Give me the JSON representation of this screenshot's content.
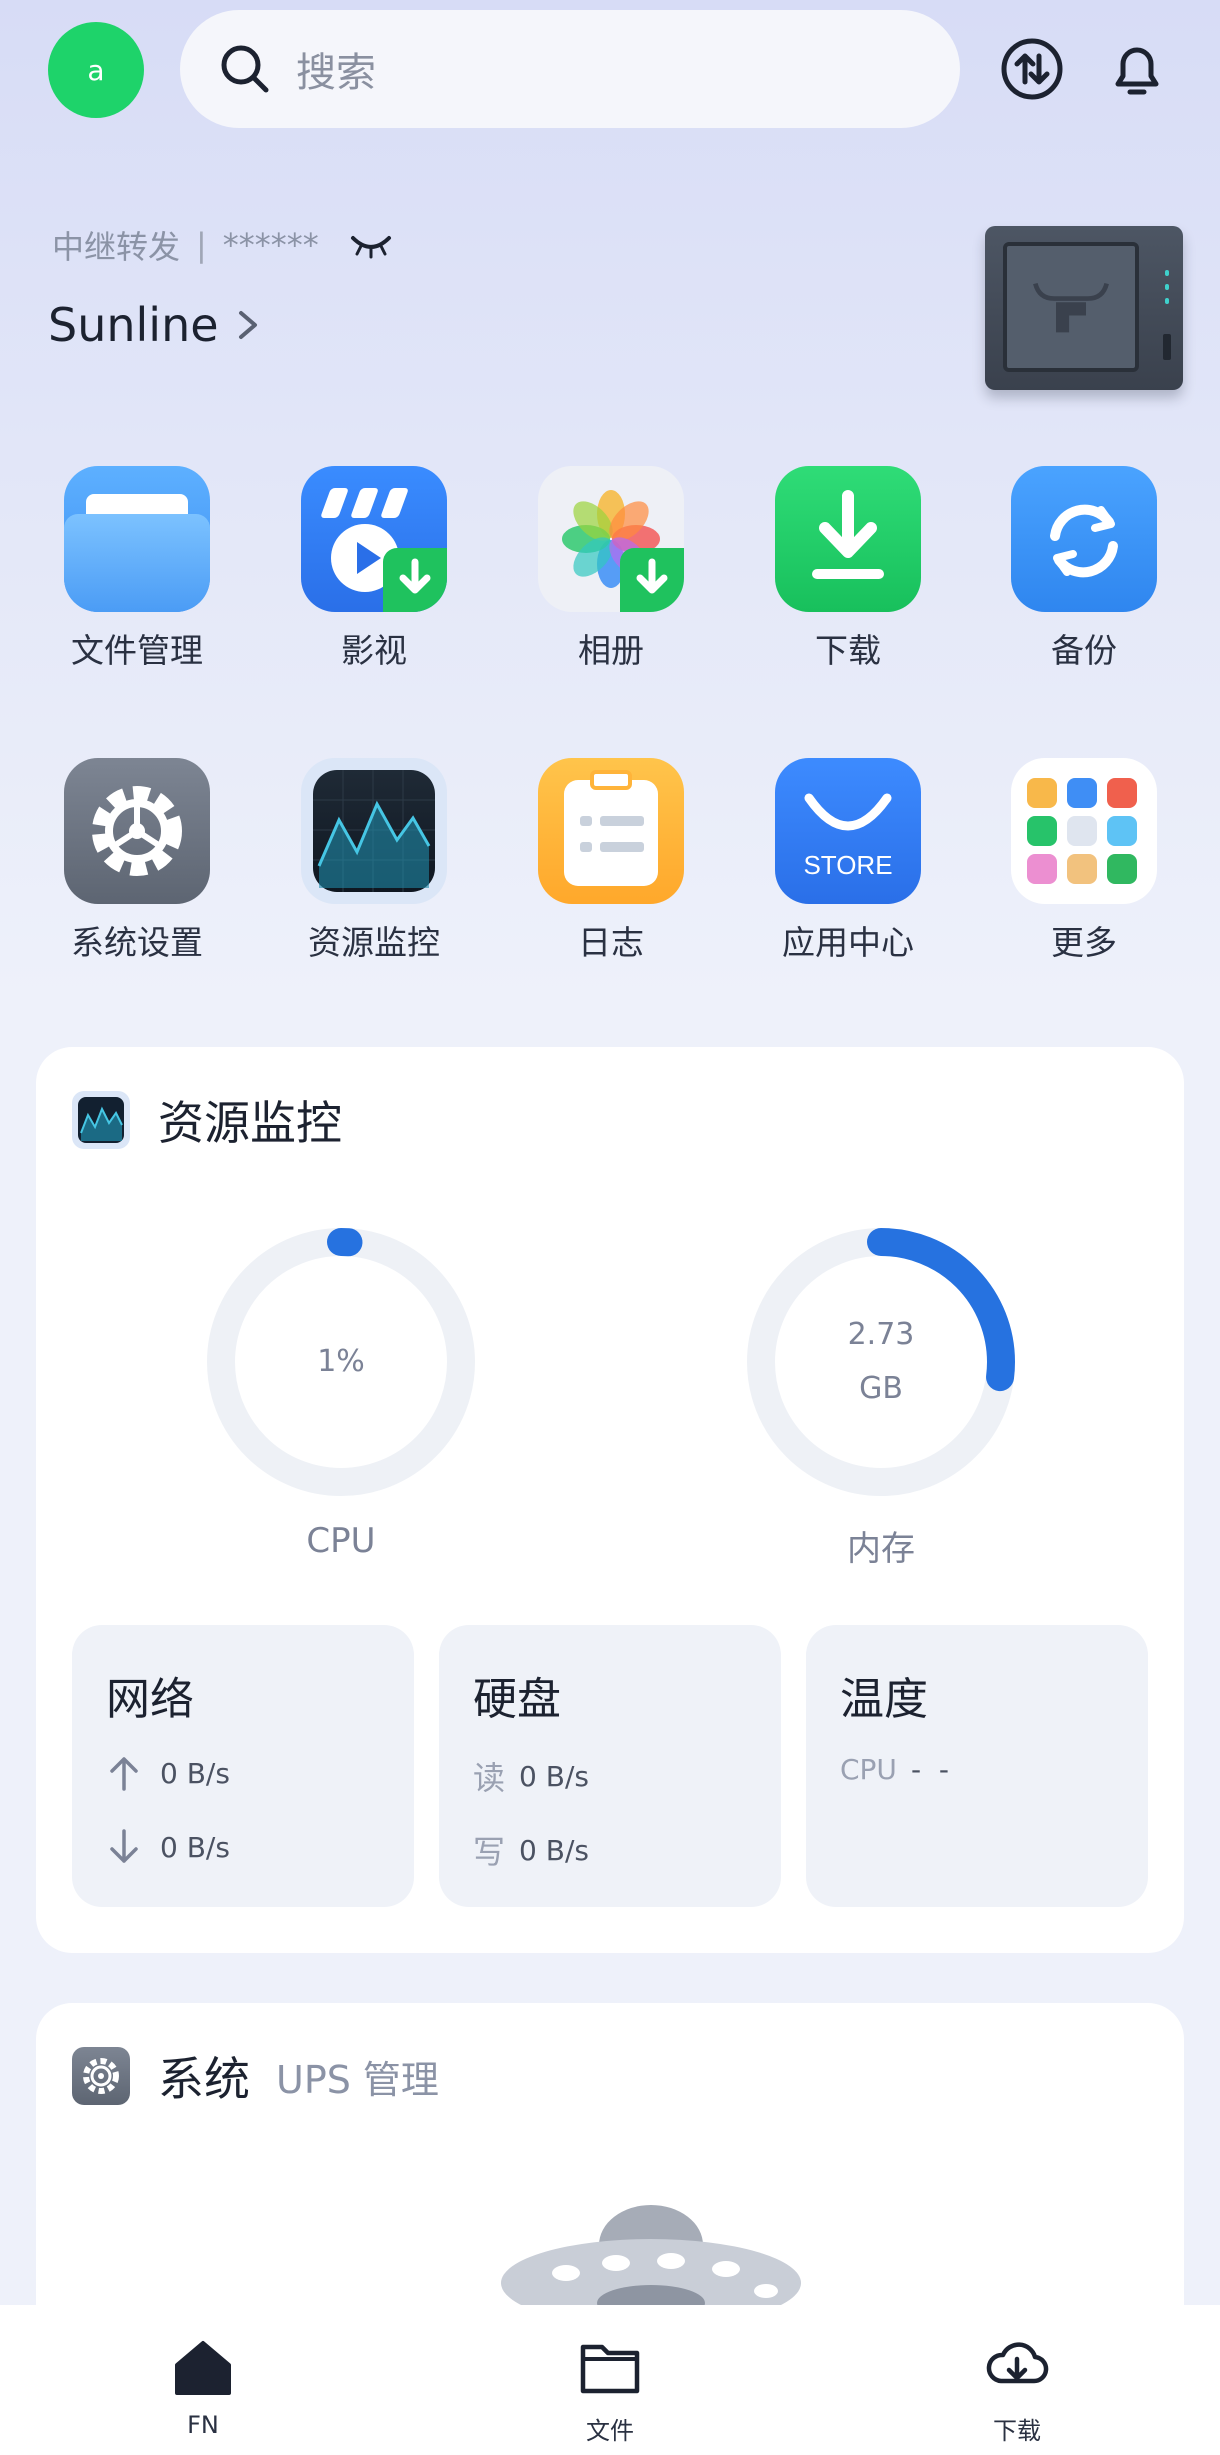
{
  "header": {
    "avatar_letter": "a",
    "search_placeholder": "搜索",
    "transfer_icon": "transfer-icon",
    "bell_icon": "bell-icon"
  },
  "device": {
    "relay_label": "中继转发",
    "separator": "|",
    "masked_password": "******",
    "name": "Sunline"
  },
  "apps": [
    {
      "label": "文件管理",
      "icon": "folder-icon"
    },
    {
      "label": "影视",
      "icon": "video-icon"
    },
    {
      "label": "相册",
      "icon": "photos-icon"
    },
    {
      "label": "下载",
      "icon": "download-icon"
    },
    {
      "label": "备份",
      "icon": "backup-icon"
    },
    {
      "label": "系统设置",
      "icon": "gear-icon"
    },
    {
      "label": "资源监控",
      "icon": "monitor-icon"
    },
    {
      "label": "日志",
      "icon": "log-icon"
    },
    {
      "label": "应用中心",
      "icon": "store-icon",
      "store_text": "STORE"
    },
    {
      "label": "更多",
      "icon": "more-icon"
    }
  ],
  "monitor": {
    "title": "资源监控",
    "cpu": {
      "label": "CPU",
      "value": "1%",
      "percent": 1
    },
    "memory": {
      "label": "内存",
      "value": "2.73",
      "unit": "GB",
      "fraction": 0.27
    },
    "network": {
      "title": "网络",
      "up": "0 B/s",
      "down": "0 B/s"
    },
    "disk": {
      "title": "硬盘",
      "read_label": "读",
      "read": "0 B/s",
      "write_label": "写",
      "write": "0 B/s"
    },
    "temperature": {
      "title": "温度",
      "cpu_label": "CPU",
      "cpu_value": "-  -"
    }
  },
  "system": {
    "title": "系统",
    "subtitle": "UPS 管理"
  },
  "bottom_nav": [
    {
      "label": "FN",
      "icon": "home-icon"
    },
    {
      "label": "文件",
      "icon": "folder-outline-icon"
    },
    {
      "label": "下载",
      "icon": "cloud-download-icon"
    }
  ],
  "colors": {
    "accent": "#1ed36a",
    "gauge": "#2672e0",
    "track": "#eef1f6"
  }
}
